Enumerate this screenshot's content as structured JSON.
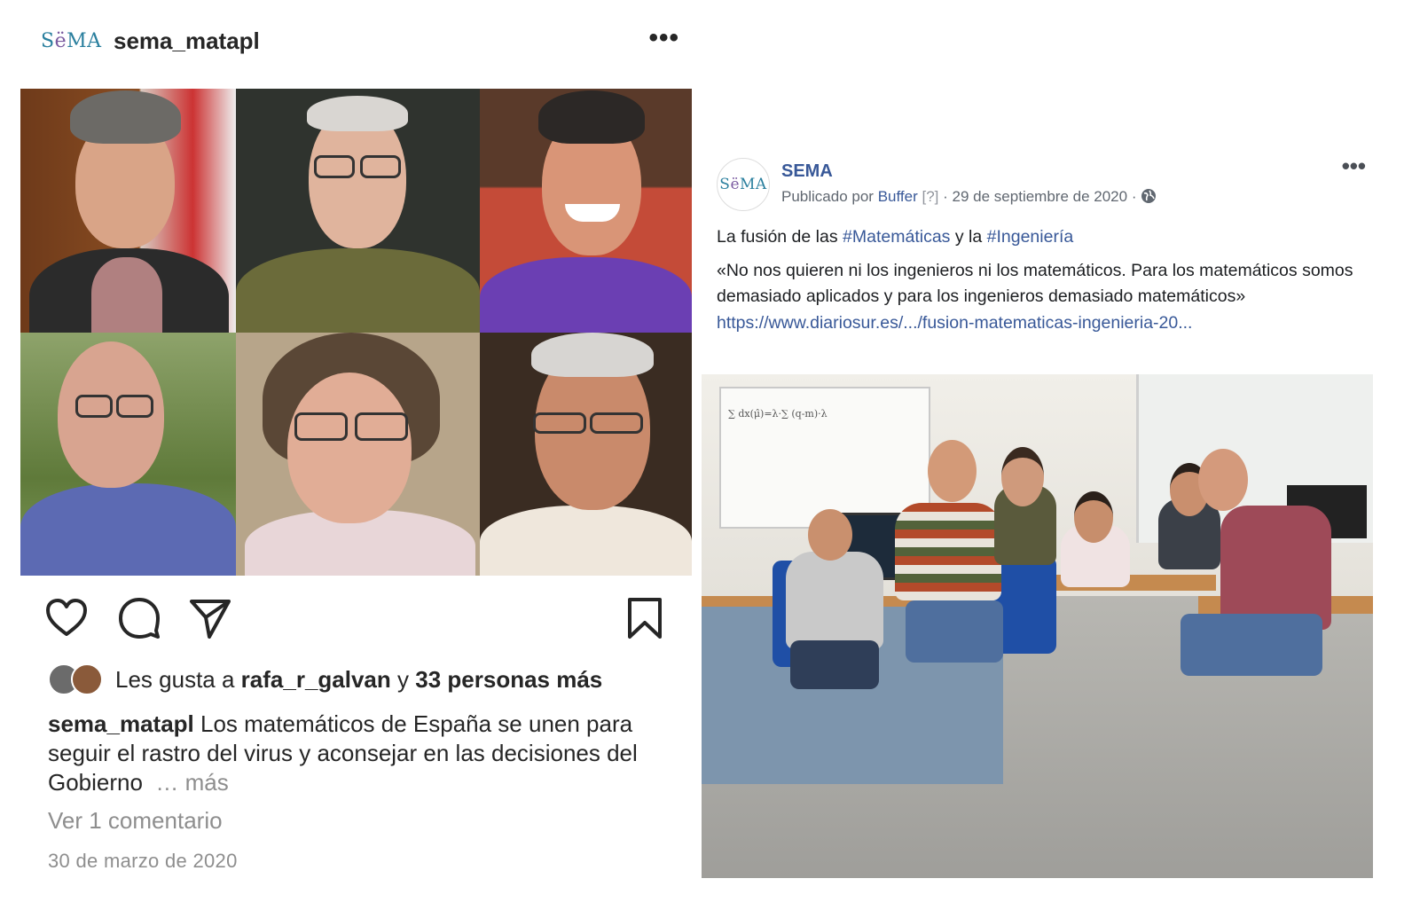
{
  "instagram": {
    "logo_text": "SëMA",
    "username": "sema_matapl",
    "more_icon": "ellipsis-icon",
    "photo_grid_count": 6,
    "actions": [
      "heart-icon",
      "comment-icon",
      "share-icon",
      "bookmark-icon"
    ],
    "likes": {
      "prefix": "Les gusta a",
      "user": "rafa_r_galvan",
      "joiner": "y",
      "others": "33 personas más"
    },
    "caption": {
      "username": "sema_matapl",
      "text": "Los matemáticos de España se unen para seguir el rastro del virus y aconsejar en las decisiones del Gobierno",
      "more": "… más"
    },
    "comments_link": "Ver 1 comentario",
    "date": "30 de marzo de 2020"
  },
  "facebook": {
    "page_name": "SEMA",
    "avatar_text": "SëMA",
    "meta": {
      "published_by": "Publicado por",
      "tool": "Buffer",
      "help": "[?]",
      "separator": "·",
      "date": "29 de septiembre de 2020",
      "separator2": "·",
      "privacy_icon": "globe-icon"
    },
    "more_icon": "ellipsis-icon",
    "headline": {
      "part1": "La fusión de las",
      "tag1": "#Matemáticas",
      "part2": "y la",
      "tag2": "#Ingeniería"
    },
    "body": {
      "quote": "«No nos quieren ni los ingenieros ni los matemáticos. Para los matemáticos somos demasiado aplicados y para los ingenieros demasiado matemáticos»",
      "url": "https://www.diariosur.es/.../fusion-matematicas-ingenieria-20..."
    },
    "photo_whiteboard": "∑ dx(μ̂)=λ·∑ (q-m)·λ"
  },
  "colors": {
    "fb_link": "#385898",
    "ig_text": "#262626",
    "ig_muted": "#8e8e8e"
  }
}
